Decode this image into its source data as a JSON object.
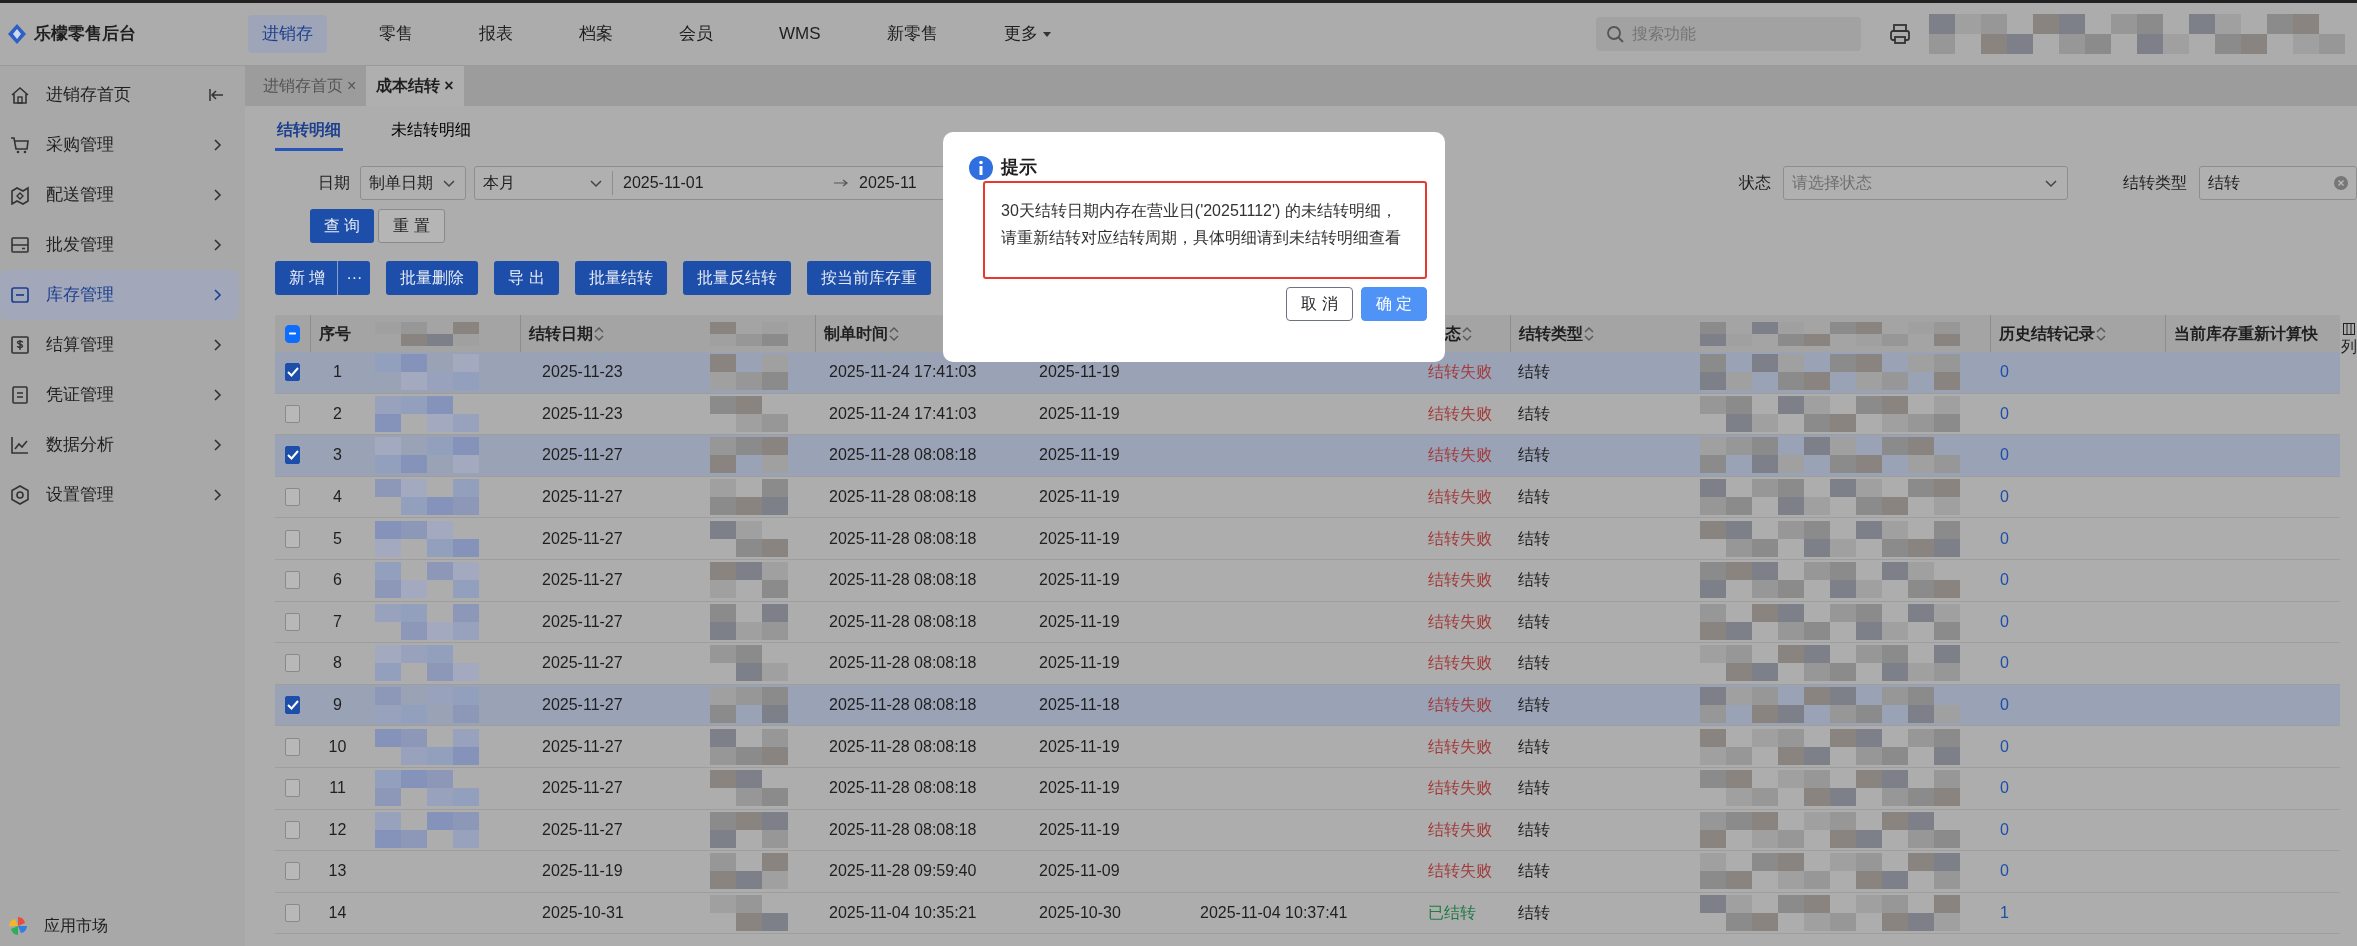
{
  "app": {
    "logo_text": "乐檬零售后台"
  },
  "top_nav": [
    {
      "label": "进销存",
      "selected": true
    },
    {
      "label": "零售",
      "selected": false
    },
    {
      "label": "报表",
      "selected": false
    },
    {
      "label": "档案",
      "selected": false
    },
    {
      "label": "会员",
      "selected": false
    },
    {
      "label": "WMS",
      "selected": false
    },
    {
      "label": "新零售",
      "selected": false
    },
    {
      "label": "更多",
      "selected": false,
      "dropdown": true
    }
  ],
  "search": {
    "placeholder": "搜索功能"
  },
  "sidebar": {
    "items": [
      {
        "label": "进销存首页",
        "selected": false
      },
      {
        "label": "采购管理",
        "selected": false
      },
      {
        "label": "配送管理",
        "selected": false
      },
      {
        "label": "批发管理",
        "selected": false
      },
      {
        "label": "库存管理",
        "selected": true
      },
      {
        "label": "结算管理",
        "selected": false
      },
      {
        "label": "凭证管理",
        "selected": false
      },
      {
        "label": "数据分析",
        "selected": false
      },
      {
        "label": "设置管理",
        "selected": false
      }
    ],
    "footer": "应用市场"
  },
  "page_tabs": [
    {
      "label": "进销存首页",
      "close": "×",
      "selected": false
    },
    {
      "label": "成本结转",
      "close": "×",
      "selected": true
    }
  ],
  "sub_tabs": [
    {
      "label": "结转明细",
      "selected": true
    },
    {
      "label": "未结转明细",
      "selected": false
    }
  ],
  "filters": {
    "date_label": "日期",
    "date_type": "制单日期",
    "period": "本月",
    "start_date": "2025-11-01",
    "end_date": "2025-11",
    "status_label": "状态",
    "status_placeholder": "请选择状态",
    "type_label": "结转类型",
    "type_value": "结转"
  },
  "query_buttons": [
    {
      "label": "查 询",
      "primary": true
    },
    {
      "label": "重 置",
      "primary": false
    }
  ],
  "actions": [
    {
      "label": "新 增",
      "more": "···"
    },
    {
      "label": "批量删除"
    },
    {
      "label": "导 出"
    },
    {
      "label": "批量结转"
    },
    {
      "label": "批量反结转"
    },
    {
      "label": "按当前库存重"
    }
  ],
  "table": {
    "columns": [
      {
        "kind": "check",
        "indeterminate": true
      },
      {
        "kind": "text",
        "label": "序号",
        "sortable": false
      },
      {
        "kind": "redacted"
      },
      {
        "kind": "text",
        "label": "结转日期",
        "sortable": true
      },
      {
        "kind": "redacted"
      },
      {
        "kind": "text",
        "label": "制单时间",
        "sortable": true
      },
      {
        "kind": "covered"
      },
      {
        "kind": "covered"
      },
      {
        "kind": "text",
        "label": "态",
        "sortable": true
      },
      {
        "kind": "text",
        "label": "结转类型",
        "sortable": true
      },
      {
        "kind": "redacted"
      },
      {
        "kind": "text",
        "label": "历史结转记录",
        "sortable": true
      },
      {
        "kind": "text",
        "label": "当前库存重新计算快",
        "sortable": false
      }
    ],
    "rows": [
      {
        "selected": true,
        "seq": "1",
        "settle_date": "2025-11-23",
        "created": "2025-11-24 17:41:03",
        "business_date": "2025-11-19",
        "status": "结转失败",
        "kind": "failed",
        "type": "结转",
        "history": "0"
      },
      {
        "selected": false,
        "seq": "2",
        "settle_date": "2025-11-23",
        "created": "2025-11-24 17:41:03",
        "business_date": "2025-11-19",
        "status": "结转失败",
        "kind": "failed",
        "type": "结转",
        "history": "0"
      },
      {
        "selected": true,
        "seq": "3",
        "settle_date": "2025-11-27",
        "created": "2025-11-28 08:08:18",
        "business_date": "2025-11-19",
        "status": "结转失败",
        "kind": "failed",
        "type": "结转",
        "history": "0"
      },
      {
        "selected": false,
        "seq": "4",
        "settle_date": "2025-11-27",
        "created": "2025-11-28 08:08:18",
        "business_date": "2025-11-19",
        "status": "结转失败",
        "kind": "failed",
        "type": "结转",
        "history": "0"
      },
      {
        "selected": false,
        "seq": "5",
        "settle_date": "2025-11-27",
        "created": "2025-11-28 08:08:18",
        "business_date": "2025-11-19",
        "status": "结转失败",
        "kind": "failed",
        "type": "结转",
        "history": "0"
      },
      {
        "selected": false,
        "seq": "6",
        "settle_date": "2025-11-27",
        "created": "2025-11-28 08:08:18",
        "business_date": "2025-11-19",
        "status": "结转失败",
        "kind": "failed",
        "type": "结转",
        "history": "0"
      },
      {
        "selected": false,
        "seq": "7",
        "settle_date": "2025-11-27",
        "created": "2025-11-28 08:08:18",
        "business_date": "2025-11-19",
        "status": "结转失败",
        "kind": "failed",
        "type": "结转",
        "history": "0"
      },
      {
        "selected": false,
        "seq": "8",
        "settle_date": "2025-11-27",
        "created": "2025-11-28 08:08:18",
        "business_date": "2025-11-19",
        "status": "结转失败",
        "kind": "failed",
        "type": "结转",
        "history": "0"
      },
      {
        "selected": true,
        "seq": "9",
        "settle_date": "2025-11-27",
        "created": "2025-11-28 08:08:18",
        "business_date": "2025-11-18",
        "status": "结转失败",
        "kind": "failed",
        "type": "结转",
        "history": "0"
      },
      {
        "selected": false,
        "seq": "10",
        "settle_date": "2025-11-27",
        "created": "2025-11-28 08:08:18",
        "business_date": "2025-11-19",
        "status": "结转失败",
        "kind": "failed",
        "type": "结转",
        "history": "0"
      },
      {
        "selected": false,
        "seq": "11",
        "settle_date": "2025-11-27",
        "created": "2025-11-28 08:08:18",
        "business_date": "2025-11-19",
        "status": "结转失败",
        "kind": "failed",
        "type": "结转",
        "history": "0"
      },
      {
        "selected": false,
        "seq": "12",
        "settle_date": "2025-11-27",
        "created": "2025-11-28 08:08:18",
        "business_date": "2025-11-19",
        "status": "结转失败",
        "kind": "failed",
        "type": "结转",
        "history": "0"
      },
      {
        "selected": false,
        "seq": "13",
        "settle_date": "2025-11-19",
        "created": "2025-11-28 09:59:40",
        "business_date": "2025-11-09",
        "status": "结转失败",
        "kind": "failed",
        "type": "结转",
        "history": "0"
      },
      {
        "selected": false,
        "seq": "14",
        "settle_date": "2025-10-31",
        "created": "2025-11-04 10:35:21",
        "business_date": "2025-10-30",
        "settled_time": "2025-11-04 10:37:41",
        "status": "已结转",
        "kind": "done",
        "type": "结转",
        "history": "1"
      }
    ]
  },
  "column_settings": "列",
  "dialog": {
    "title": "提示",
    "message": "30天结转日期内存在营业日('20251112') 的未结转明细，请重新结转对应结转周期，具体明细请到未结转明细查看",
    "buttons": [
      {
        "label": "取 消",
        "primary": false
      },
      {
        "label": "确 定",
        "primary": true
      }
    ]
  }
}
